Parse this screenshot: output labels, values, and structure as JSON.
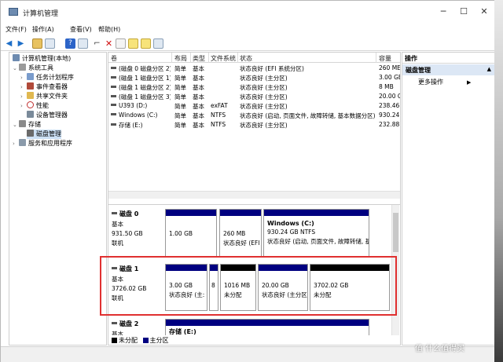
{
  "window": {
    "title": "计算机管理",
    "minimize": "─",
    "maximize": "☐",
    "close": "✕"
  },
  "menu": [
    "文件(F)",
    "操作(A)",
    "查看(V)",
    "帮助(H)"
  ],
  "tree": [
    {
      "label": "计算机管理(本地)",
      "level": 0
    },
    {
      "label": "系统工具",
      "level": 1
    },
    {
      "label": "任务计划程序",
      "level": 2
    },
    {
      "label": "事件查看器",
      "level": 2
    },
    {
      "label": "共享文件夹",
      "level": 2
    },
    {
      "label": "性能",
      "level": 2
    },
    {
      "label": "设备管理器",
      "level": 2
    },
    {
      "label": "存储",
      "level": 1
    },
    {
      "label": "磁盘管理",
      "level": 2,
      "selected": true
    },
    {
      "label": "服务和应用程序",
      "level": 1
    }
  ],
  "columns": [
    "卷",
    "布局",
    "类型",
    "文件系统",
    "状态",
    "容量"
  ],
  "volumes": [
    {
      "name": "(磁盘 0 磁盘分区 2)",
      "layout": "简单",
      "type": "基本",
      "fs": "",
      "status": "状态良好 (EFI 系统分区)",
      "cap": "260 ME"
    },
    {
      "name": "(磁盘 1 磁盘分区 1)",
      "layout": "简单",
      "type": "基本",
      "fs": "",
      "status": "状态良好 (主分区)",
      "cap": "3.00 GE"
    },
    {
      "name": "(磁盘 1 磁盘分区 2)",
      "layout": "简单",
      "type": "基本",
      "fs": "",
      "status": "状态良好 (主分区)",
      "cap": "8 MB"
    },
    {
      "name": "(磁盘 1 磁盘分区 3)",
      "layout": "简单",
      "type": "基本",
      "fs": "",
      "status": "状态良好 (主分区)",
      "cap": "20.00 G"
    },
    {
      "name": "U393 (D:)",
      "layout": "简单",
      "type": "基本",
      "fs": "exFAT",
      "status": "状态良好 (主分区)",
      "cap": "238.46"
    },
    {
      "name": "Windows (C:)",
      "layout": "简单",
      "type": "基本",
      "fs": "NTFS",
      "status": "状态良好 (启动, 页面文件, 故障转储, 基本数据分区)",
      "cap": "930.24"
    },
    {
      "name": "存储 (E:)",
      "layout": "简单",
      "type": "基本",
      "fs": "NTFS",
      "status": "状态良好 (主分区)",
      "cap": "232.88"
    }
  ],
  "disks": [
    {
      "name": "磁盘 0",
      "type": "基本",
      "size": "931.50 GB",
      "state": "联机",
      "parts": [
        {
          "title": "",
          "line1": "1.00 GB",
          "line2": "",
          "bar": "#000080"
        },
        {
          "title": "",
          "line1": "260 MB",
          "line2": "状态良好 (EFI",
          "bar": "#000080"
        },
        {
          "title": "Windows (C:)",
          "line1": "930.24 GB NTFS",
          "line2": "状态良好 (启动, 页面文件, 故障转储, 基",
          "bar": "#000080"
        }
      ]
    },
    {
      "name": "磁盘 1",
      "type": "基本",
      "size": "3726.02 GB",
      "state": "联机",
      "parts": [
        {
          "title": "",
          "line1": "3.00 GB",
          "line2": "状态良好 (主:",
          "bar": "#000080"
        },
        {
          "title": "",
          "line1": "8",
          "line2": "",
          "bar": "#000080"
        },
        {
          "title": "",
          "line1": "1016 MB",
          "line2": "未分配",
          "bar": "#000000"
        },
        {
          "title": "",
          "line1": "20.00 GB",
          "line2": "状态良好 (主分区",
          "bar": "#000080"
        },
        {
          "title": "",
          "line1": "3702.02 GB",
          "line2": "未分配",
          "bar": "#000000"
        }
      ]
    },
    {
      "name": "磁盘 2",
      "type": "基本",
      "size": "",
      "state": "",
      "parts": [
        {
          "title": "存储 (E:)",
          "line1": "",
          "line2": "",
          "bar": "#000080"
        }
      ]
    }
  ],
  "legend": {
    "unallocated": "未分配",
    "primary": "主分区"
  },
  "actions": {
    "header": "操作",
    "selected": "磁盘管理",
    "more": "更多操作"
  },
  "watermark": "值 什么值得买"
}
